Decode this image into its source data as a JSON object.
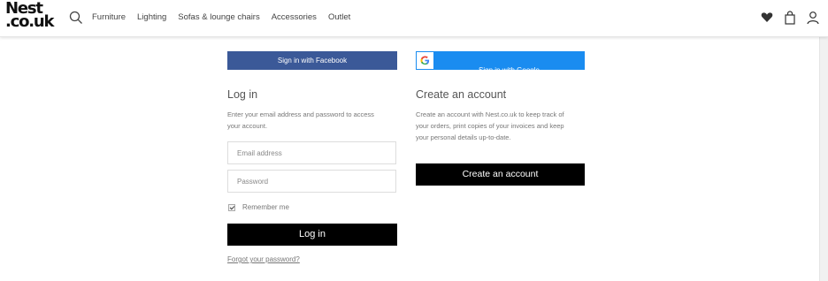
{
  "header": {
    "logo_line1": "Nest",
    "logo_line2": ".co.uk",
    "nav": [
      "Furniture",
      "Lighting",
      "Sofas & lounge chairs",
      "Accessories",
      "Outlet"
    ],
    "icons": [
      "search-icon",
      "heart-icon",
      "bag-icon",
      "account-icon"
    ]
  },
  "social": {
    "facebook_label": "Sign in with Facebook",
    "facebook_color": "#3b5998",
    "google_label": "Sign in with Google",
    "google_color": "#1a8cf0"
  },
  "login": {
    "title": "Log in",
    "description": "Enter your email address and password to access your account.",
    "email_placeholder": "Email address",
    "password_placeholder": "Password",
    "remember_label": "Remember me",
    "remember_checked": true,
    "submit_label": "Log in",
    "forgot_label": "Forgot your password?"
  },
  "create": {
    "title": "Create an account",
    "description": "Create an account with Nest.co.uk to keep track of your orders, print copies of your invoices and keep your personal details up-to-date.",
    "button_label": "Create an account"
  }
}
